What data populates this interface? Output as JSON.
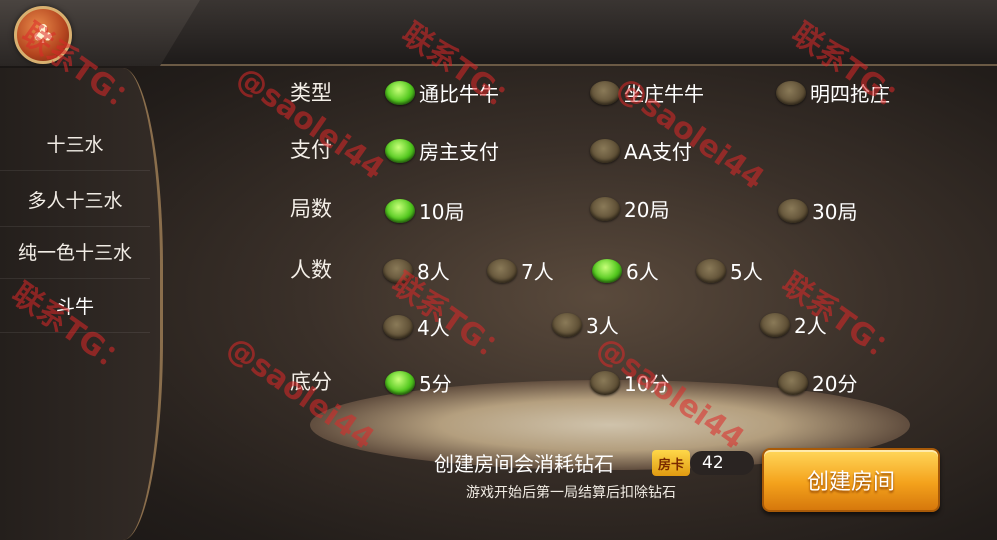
{
  "sidebar": {
    "items": [
      {
        "label": "十三水"
      },
      {
        "label": "多人十三水"
      },
      {
        "label": "纯一色十三水"
      },
      {
        "label": "斗牛"
      }
    ]
  },
  "rows": {
    "type": {
      "label": "类型",
      "options": [
        {
          "label": "通比牛牛",
          "selected": true
        },
        {
          "label": "坐庄牛牛",
          "selected": false
        },
        {
          "label": "明四抢庄",
          "selected": false
        }
      ]
    },
    "pay": {
      "label": "支付",
      "options": [
        {
          "label": "房主支付",
          "selected": true
        },
        {
          "label": "AA支付",
          "selected": false
        }
      ]
    },
    "rounds": {
      "label": "局数",
      "options": [
        {
          "label": "10局",
          "selected": true
        },
        {
          "label": "20局",
          "selected": false
        },
        {
          "label": "30局",
          "selected": false
        }
      ]
    },
    "players": {
      "label": "人数",
      "options": [
        {
          "label": "8人",
          "selected": false
        },
        {
          "label": "7人",
          "selected": false
        },
        {
          "label": "6人",
          "selected": true
        },
        {
          "label": "5人",
          "selected": false
        },
        {
          "label": "4人",
          "selected": false
        },
        {
          "label": "3人",
          "selected": false
        },
        {
          "label": "2人",
          "selected": false
        }
      ]
    },
    "base": {
      "label": "底分",
      "options": [
        {
          "label": "5分",
          "selected": true
        },
        {
          "label": "10分",
          "selected": false
        },
        {
          "label": "20分",
          "selected": false
        }
      ]
    }
  },
  "footer": {
    "cost_text": "创建房间会消耗钻石",
    "card_label": "房卡",
    "card_count": "42",
    "note": "游戏开始后第一局结算后扣除钻石",
    "create_label": "创建房间"
  },
  "watermark": {
    "line1": "联系TG：",
    "line2": "@saolei44"
  },
  "colors": {
    "selected": "#52c81e",
    "button": "#f4a21c"
  }
}
